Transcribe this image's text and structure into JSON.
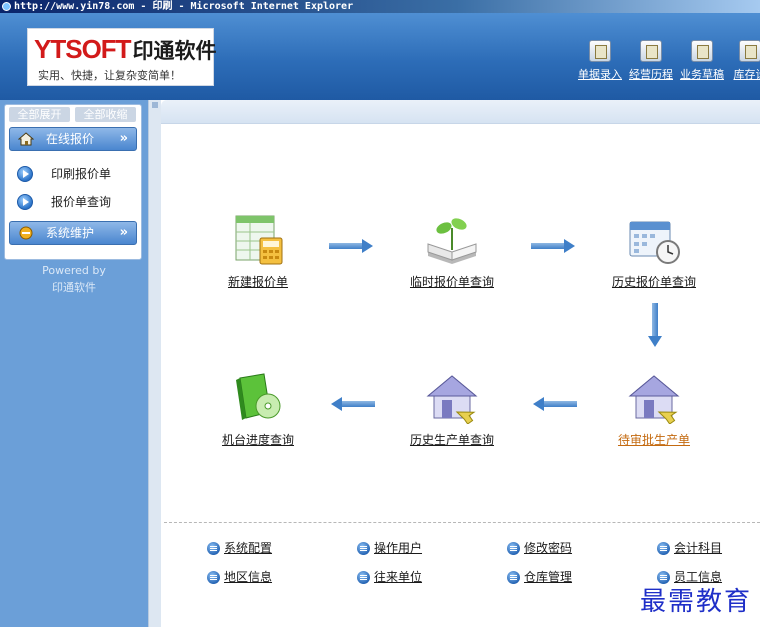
{
  "window": {
    "title": "http://www.yin78.com - 印刷 - Microsoft Internet Explorer"
  },
  "logo": {
    "brand": "YTSOFT",
    "brand_cn": "印通软件",
    "slogan": "实用、快捷，让复杂变简单！"
  },
  "toolbar": {
    "items": [
      {
        "label": "单据录入",
        "icon": "pen-document-icon"
      },
      {
        "label": "经营历程",
        "icon": "calculator-icon"
      },
      {
        "label": "业务草稿",
        "icon": "notepad-icon"
      },
      {
        "label": "库存设",
        "icon": "bar-chart-icon"
      }
    ]
  },
  "sidebar": {
    "expand_all": "全部展开",
    "collapse_all": "全部收缩",
    "groups": [
      {
        "label": "在线报价",
        "icon": "home-icon",
        "items": [
          "印刷报价单",
          "报价单查询"
        ]
      },
      {
        "label": "系统维护",
        "icon": "wrench-icon",
        "items": []
      }
    ],
    "powered_by": "Powered by",
    "powered_name": "印通软件"
  },
  "flow": {
    "nodes": [
      {
        "label": "新建报价单",
        "icon": "spreadsheet-calculator-icon"
      },
      {
        "label": "临时报价单查询",
        "icon": "open-book-sprout-icon"
      },
      {
        "label": "历史报价单查询",
        "icon": "calendar-clock-icon"
      },
      {
        "label": "待审批生产单",
        "icon": "house-arrow-icon",
        "active": true
      },
      {
        "label": "历史生产单查询",
        "icon": "house-arrow-icon"
      },
      {
        "label": "机台进度查询",
        "icon": "green-disc-box-icon"
      }
    ]
  },
  "quick_links": [
    "系统配置",
    "操作用户",
    "修改密码",
    "会计科目",
    "地区信息",
    "往来单位",
    "仓库管理",
    "员工信息"
  ],
  "watermark": "最需教育",
  "colors": {
    "header": "#2d6db8",
    "sidebar": "#6b9fd8",
    "active_link": "#c46a10",
    "watermark": "#1f2fc8"
  }
}
